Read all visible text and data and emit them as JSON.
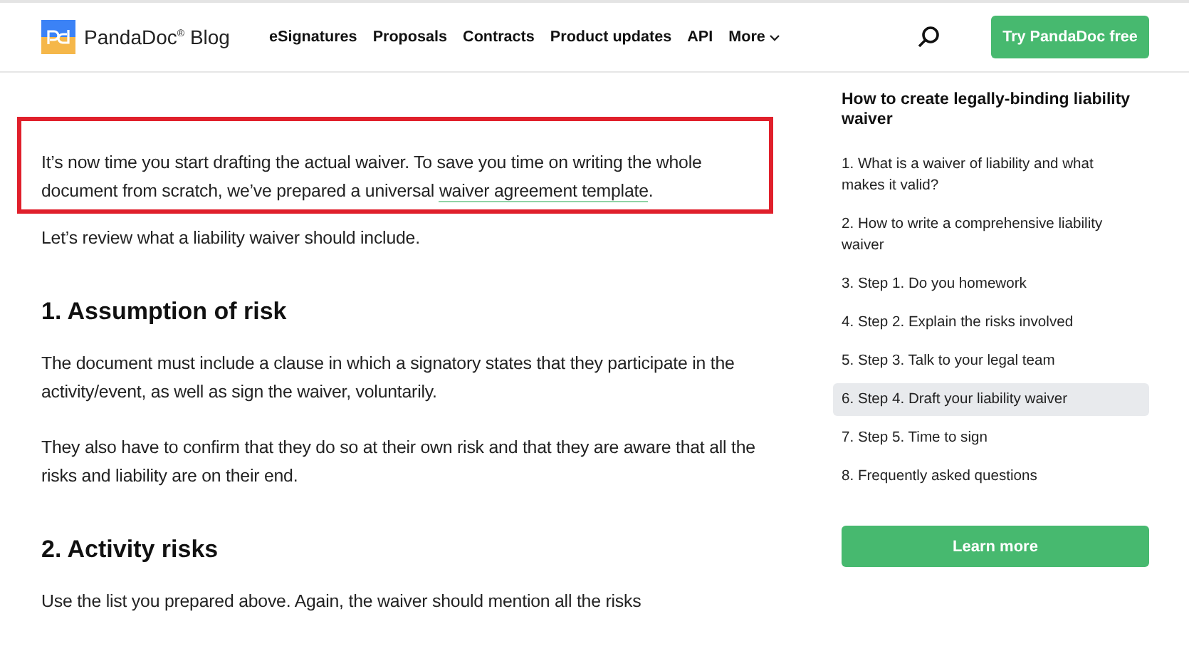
{
  "header": {
    "logo_text": "PandaDoc$^{®}$ Blog",
    "nav": [
      {
        "label": "eSignatures",
        "kind": "link"
      },
      {
        "label": "Proposals",
        "kind": "link"
      },
      {
        "label": "Contracts",
        "kind": "link"
      },
      {
        "label": "Product updates",
        "kind": "link"
      },
      {
        "label": "API",
        "kind": "link"
      },
      {
        "label": "More",
        "kind": "dropdown"
      }
    ],
    "cta": "Try PandaDoc free"
  },
  "article": [
    {
      "kind": "highlighted_paragraph",
      "text": "It’s now time you start drafting the actual waiver. To save you time on writing the whole document from scratch, we’ve prepared a universal ",
      "link": "waiver agreement template",
      "after": "."
    },
    {
      "kind": "paragraph",
      "text": "Let’s review what a liability waiver should include."
    },
    {
      "kind": "heading",
      "text": "1. Assumption of risk"
    },
    {
      "kind": "paragraph",
      "text": "The document must include a clause in which a signatory states that they participate in the activity/event, as well as sign the waiver, voluntarily."
    },
    {
      "kind": "paragraph",
      "text": "They also have to confirm that they do so at their own risk and that they are aware that all the risks and liability are on their end."
    },
    {
      "kind": "heading",
      "text": "2. Activity risks"
    },
    {
      "kind": "paragraph",
      "text": "Use the list you prepared above. Again, the waiver should mention all the risks"
    }
  ],
  "toc": {
    "title": "How to create legally-binding liability waiver",
    "items": [
      {
        "label": "1. What is a waiver of liability and what makes it valid?",
        "selected": false
      },
      {
        "label": "2. How to write a comprehensive liability waiver",
        "selected": false
      },
      {
        "label": "3. Step 1. Do you homework",
        "selected": false
      },
      {
        "label": "4. Step 2. Explain the risks involved",
        "selected": false
      },
      {
        "label": "5. Step 3. Talk to your legal team",
        "selected": false
      },
      {
        "label": "6. Step 4. Draft your liability waiver",
        "selected": true
      },
      {
        "label": "7. Step 5. Time to sign",
        "selected": false
      },
      {
        "label": "8. Frequently asked questions",
        "selected": false
      }
    ],
    "button": "Learn more"
  }
}
